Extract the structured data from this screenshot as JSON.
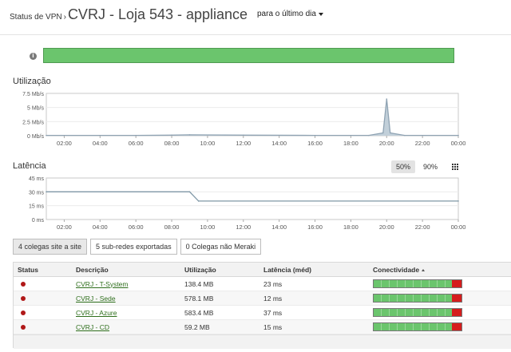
{
  "header": {
    "breadcrumb": "Status de VPN",
    "separator": "›",
    "title": "CVRJ - Loja 543 - appliance",
    "range": "para o último dia"
  },
  "status": {
    "info_icon": "info-icon",
    "bar_color": "#6bc56d"
  },
  "utilization": {
    "label": "Utilização"
  },
  "latency": {
    "label": "Latência",
    "pct_options": [
      "50%",
      "90%"
    ],
    "selected": "50%",
    "grid_icon": "grid-icon"
  },
  "chart_data": [
    {
      "type": "area",
      "ylabel": "",
      "y_ticks": [
        "7.5 Mb/s",
        "5 Mb/s",
        "2.5 Mb/s",
        "0 Mb/s"
      ],
      "ylim": [
        0,
        7.5
      ],
      "x_ticks": [
        "02:00",
        "04:00",
        "06:00",
        "08:00",
        "10:00",
        "12:00",
        "14:00",
        "16:00",
        "18:00",
        "20:00",
        "22:00",
        "00:00"
      ],
      "xlim": [
        1,
        24
      ],
      "x": [
        1,
        6,
        8,
        9,
        12,
        16,
        19,
        19.8,
        20,
        20.2,
        21,
        24
      ],
      "values": [
        0.05,
        0.05,
        0.1,
        0.15,
        0.1,
        0.05,
        0.05,
        0.5,
        6.5,
        0.5,
        0.05,
        0.05
      ],
      "color": "#8fa3b3",
      "grid": true
    },
    {
      "type": "line",
      "ylabel": "",
      "y_ticks": [
        "45 ms",
        "30 ms",
        "15 ms",
        "0 ms"
      ],
      "ylim": [
        0,
        45
      ],
      "x_ticks": [
        "02:00",
        "04:00",
        "06:00",
        "08:00",
        "10:00",
        "12:00",
        "14:00",
        "16:00",
        "18:00",
        "20:00",
        "22:00",
        "00:00"
      ],
      "xlim": [
        1,
        24
      ],
      "x": [
        1,
        9,
        9.5,
        24
      ],
      "values": [
        30,
        30,
        20,
        20
      ],
      "color": "#7f97a6",
      "grid": true
    }
  ],
  "tabs": [
    "4 colegas site a site",
    "5 sub-redes exportadas",
    "0 Colegas não Meraki"
  ],
  "table": {
    "headers": [
      "Status",
      "Descrição",
      "Utilização",
      "Latência (méd)",
      "Conectividade"
    ],
    "rows": [
      {
        "description": "CVRJ - T-System",
        "utilization": "138.4 MB",
        "latency": "23 ms"
      },
      {
        "description": "CVRJ - Sede",
        "utilization": "578.1 MB",
        "latency": "12 ms"
      },
      {
        "description": "CVRJ - Azure",
        "utilization": "583.4 MB",
        "latency": "37 ms"
      },
      {
        "description": "CVRJ - CD",
        "utilization": "59.2 MB",
        "latency": "15 ms"
      }
    ],
    "status_color": "#b01818"
  }
}
